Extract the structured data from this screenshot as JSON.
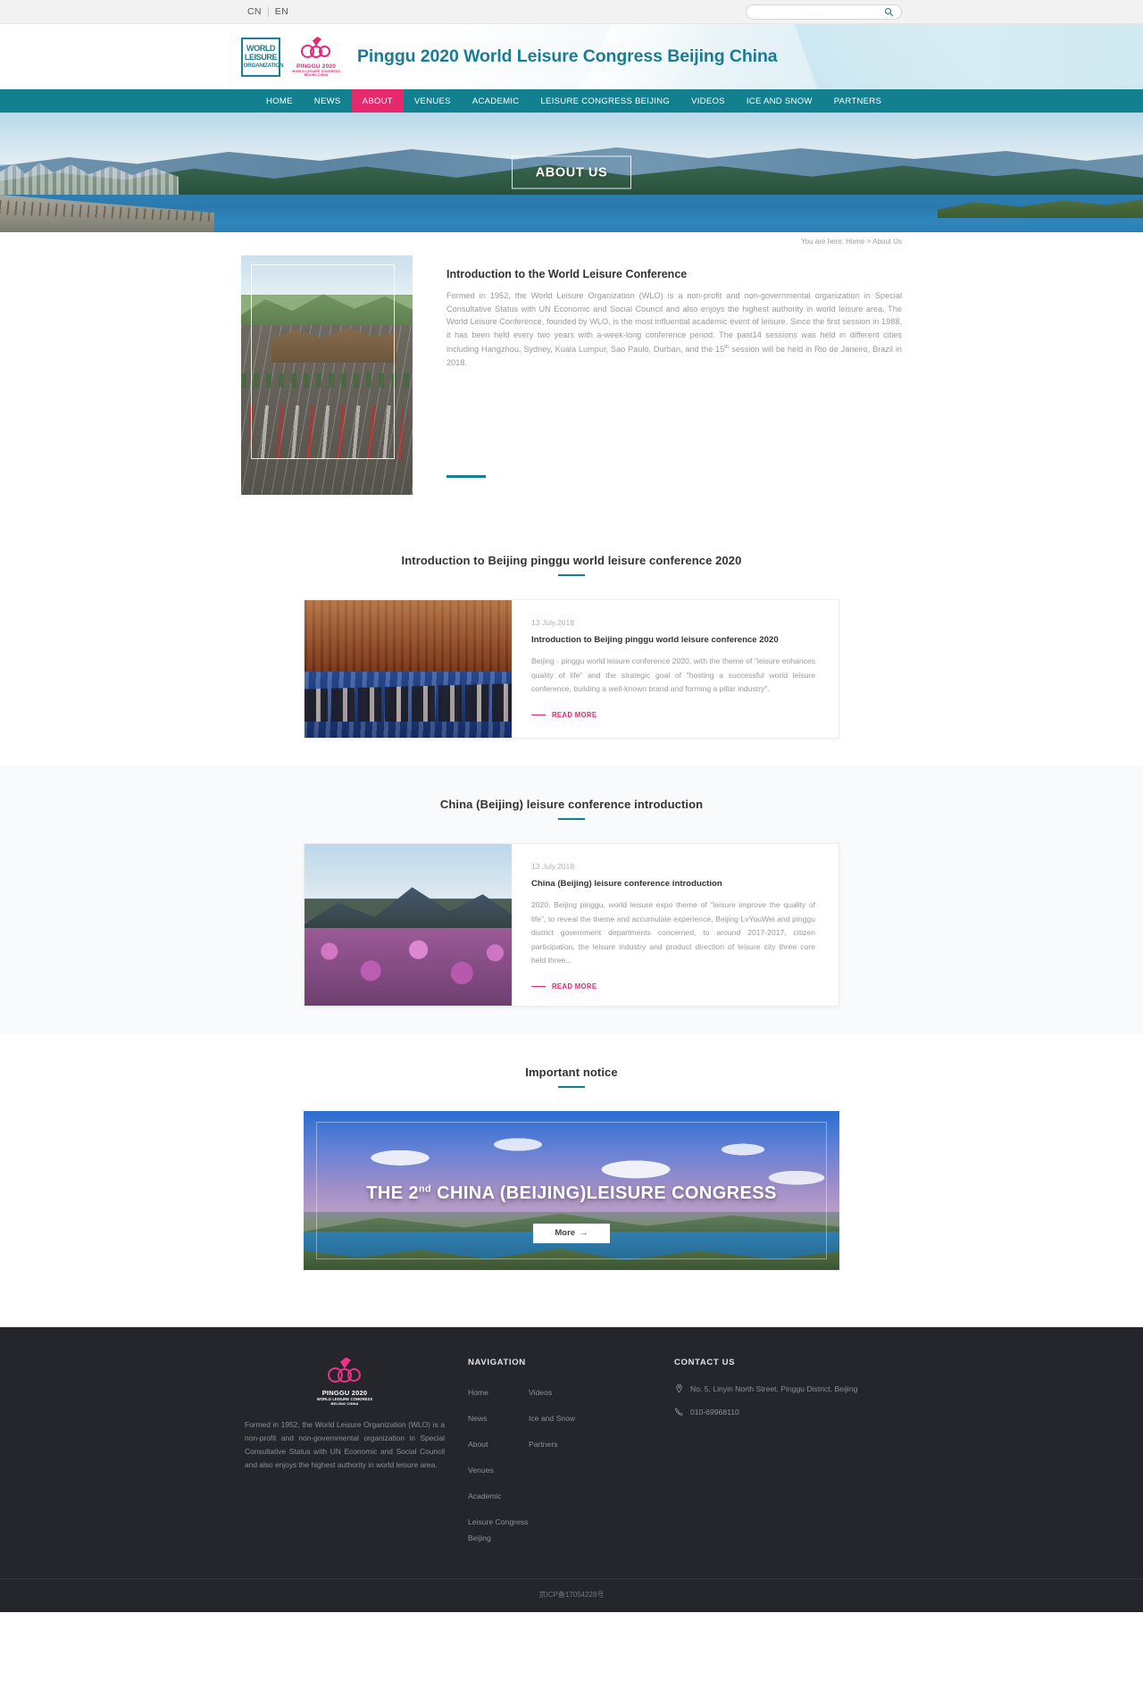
{
  "topbar": {
    "lang_cn": "CN",
    "lang_en": "EN",
    "search_placeholder": "",
    "search_value": "",
    "search_icon": "search-icon"
  },
  "header": {
    "site_title": "Pinggu 2020 World Leisure Congress Beijing China",
    "wlo_logo": {
      "l1": "WORLD",
      "l2": "LEISURE",
      "l3": "ORGANIZATION"
    },
    "pinggu_logo": {
      "year": "2020",
      "l1": "PINGGU 2020",
      "l2": "WORLD LEISURE CONGRESS",
      "l3": "BEIJING CHINA"
    },
    "brand_color": "#1a7c93",
    "accent_color": "#e6286d"
  },
  "nav": {
    "items": [
      {
        "label": "HOME",
        "active": false
      },
      {
        "label": "NEWS",
        "active": false
      },
      {
        "label": "ABOUT",
        "active": true
      },
      {
        "label": "VENUES",
        "active": false
      },
      {
        "label": "ACADEMIC",
        "active": false
      },
      {
        "label": "LEISURE CONGRESS BEIJING",
        "active": false
      },
      {
        "label": "VIDEOS",
        "active": false
      },
      {
        "label": "ICE AND SNOW",
        "active": false
      },
      {
        "label": "PARTNERS",
        "active": false
      }
    ],
    "bg_color": "#13808f",
    "active_color": "#e6286d"
  },
  "hero": {
    "label": "ABOUT US"
  },
  "breadcrumb": {
    "prefix": "You are here:",
    "home": "Home",
    "separator": ">",
    "current": "About Us"
  },
  "intro": {
    "title": "Introduction to the World Leisure Conference",
    "text_part1": "Formed in 1952, the World Leisure Organization (WLO) is a non-profit and non-governmental organization in Special Consultative Status with UN Economic and Social Council and also enjoys the highest authority in world leisure area. The World Leisure Conference, founded by WLO, is the most influential academic event of leisure. Since the first session in 1988, it has been held every two years with a-week-long conference period. The past14 sessions was held in different cities including Hangzhou, Sydney, Kuala Lumpur, Sao Paulo, Durban, and the 15",
    "text_sup": "th",
    "text_part2": " session will be held in Rio de Janeiro, Brazil in 2018."
  },
  "sections": [
    {
      "title": "Introduction to Beijing pinggu world leisure conference 2020",
      "card": {
        "date": "13 July,2018",
        "title": "Introduction to Beijing pinggu world leisure conference 2020",
        "text": "Beijing · pinggu world leisure conference 2020, with the theme of \"leisure enhances quality of life\" and the strategic goal of \"hosting a successful world leisure conference, building a well-known brand and forming a pillar industry\".",
        "readmore": "READ MORE"
      }
    },
    {
      "title": "China (Beijing) leisure conference introduction",
      "card": {
        "date": "13 July,2018",
        "title": "China (Beijing) leisure conference introduction",
        "text": "2020, Beijing pinggu, world leisure expo theme of \"leisure improve the quality of life\", to reveal the theme and accumulate experience, Beijing LvYouWei and pinggu district government departments concerned, to around 2017-2017, citizen participation, the leisure industry and product direction of leisure city three core held three...",
        "readmore": "READ MORE"
      }
    }
  ],
  "notice": {
    "title": "Important notice",
    "banner_title_part1": "THE 2",
    "banner_title_sup": "nd",
    "banner_title_part2": " CHINA (BEIJING)LEISURE CONGRESS",
    "more_label": "More",
    "more_arrow": "→"
  },
  "footer": {
    "logo": {
      "year": "2020",
      "l1": "PINGGU 2020",
      "l2": "WORLD LEISURE CONGRESS",
      "l3": "BEIJING CHINA"
    },
    "about_text": "Formed in 1952, the World Leisure Organization (WLO) is a non-profit and non-governmental organization in Special Consultative Status with UN Economic and Social Council and also enjoys the highest authority in world leisure area.",
    "nav_heading": "NAVIGATION",
    "nav_col1": [
      "Home",
      "News",
      "About",
      "Venues",
      "Academic",
      "Leisure Congress Beijing"
    ],
    "nav_col2": [
      "Videos",
      "Ice and Snow",
      "Partners"
    ],
    "contact_heading": "CONTACT US",
    "address": "No. 5, Linyin North Street, Pinggu District, Beijing",
    "phone": "010-69968110",
    "icp": "京ICP备17054228号"
  }
}
